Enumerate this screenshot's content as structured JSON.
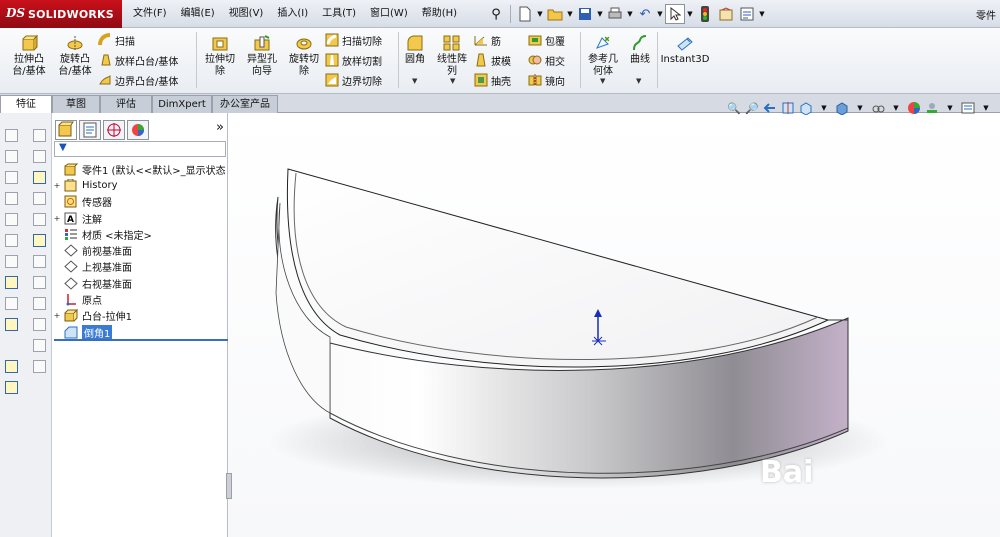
{
  "logo": {
    "ds": "DS",
    "brand": "SOLIDWORKS"
  },
  "menus": [
    {
      "label": "文件(F)"
    },
    {
      "label": "编辑(E)"
    },
    {
      "label": "视图(V)"
    },
    {
      "label": "插入(I)"
    },
    {
      "label": "工具(T)"
    },
    {
      "label": "窗口(W)"
    },
    {
      "label": "帮助(H)"
    }
  ],
  "title_right": "零件",
  "ribbon": {
    "extrude_boss": "拉伸凸\n台/基体",
    "revolve_boss": "旋转凸\n台/基体",
    "sweep": "扫描",
    "loft": "放样凸台/基体",
    "boundary_boss": "边界凸台/基体",
    "extrude_cut": "拉伸切\n除",
    "hole_wizard": "异型孔\n向导",
    "revolve_cut": "旋转切\n除",
    "sweep_cut": "扫描切除",
    "loft_cut": "放样切割",
    "boundary_cut": "边界切除",
    "fillet": "圆角",
    "linear_pattern": "线性阵\n列",
    "rib": "筋",
    "draft": "拔模",
    "shell": "抽壳",
    "wrap": "包覆",
    "intersect": "相交",
    "mirror": "镜向",
    "ref_geometry": "参考几\n何体",
    "curves": "曲线",
    "instant3d": "Instant3D"
  },
  "tabs": [
    {
      "label": "特征"
    },
    {
      "label": "草图"
    },
    {
      "label": "评估"
    },
    {
      "label": "DimXpert"
    },
    {
      "label": "办公室产品"
    }
  ],
  "tree": {
    "collapse": "»",
    "filter_icon": "funnel-icon",
    "items": [
      {
        "label": "零件1  (默认<<默认>_显示状态",
        "toggle": "",
        "icon": "part-icon"
      },
      {
        "label": "History",
        "toggle": "+",
        "icon": "history-icon"
      },
      {
        "label": "传感器",
        "toggle": "",
        "icon": "sensor-icon"
      },
      {
        "label": "注解",
        "toggle": "+",
        "icon": "annotation-icon"
      },
      {
        "label": "材质 <未指定>",
        "toggle": "",
        "icon": "material-icon"
      },
      {
        "label": "前视基准面",
        "toggle": "",
        "icon": "plane-icon"
      },
      {
        "label": "上视基准面",
        "toggle": "",
        "icon": "plane-icon"
      },
      {
        "label": "右视基准面",
        "toggle": "",
        "icon": "plane-icon"
      },
      {
        "label": "原点",
        "toggle": "",
        "icon": "origin-icon"
      },
      {
        "label": "凸台-拉伸1",
        "toggle": "+",
        "icon": "extrude-icon"
      },
      {
        "label": "倒角1",
        "toggle": "",
        "icon": "chamfer-icon"
      }
    ]
  },
  "watermark": "Bai",
  "colors": {
    "selection": "#3a7bd5",
    "logo_red": "#b0121a",
    "model_light": "#f4f4f4",
    "model_purple": "#c4b1c9"
  }
}
